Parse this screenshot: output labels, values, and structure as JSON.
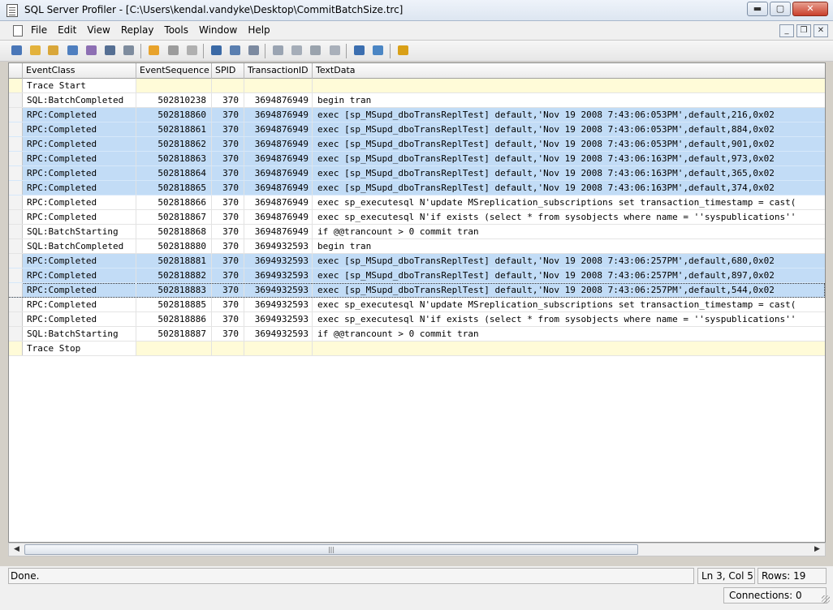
{
  "window": {
    "title": "SQL Server Profiler - [C:\\Users\\kendal.vandyke\\Desktop\\CommitBatchSize.trc]",
    "minimize_glyph": "▬",
    "maximize_glyph": "▢",
    "close_glyph": "✕"
  },
  "menu": {
    "items": [
      "File",
      "Edit",
      "View",
      "Replay",
      "Tools",
      "Window",
      "Help"
    ],
    "mdi_minimize": "_",
    "mdi_restore": "❐",
    "mdi_close": "✕"
  },
  "toolbar": {
    "icons": [
      {
        "name": "new-trace-icon",
        "color": "#4a77b8"
      },
      {
        "name": "new-template-icon",
        "color": "#e3b23c"
      },
      {
        "name": "open-icon",
        "color": "#d9a73a"
      },
      {
        "name": "save-icon",
        "color": "#4f7fbf"
      },
      {
        "name": "properties-icon",
        "color": "#8d6fb3"
      },
      {
        "name": "find-icon",
        "color": "#556f93"
      },
      {
        "name": "clear-trace-icon",
        "color": "#7e8c9e"
      },
      {
        "name": "run-trace-icon",
        "color": "#e8a32c"
      },
      {
        "name": "pause-trace-icon",
        "color": "#9c9c9c"
      },
      {
        "name": "stop-trace-icon",
        "color": "#b0b0b0"
      },
      {
        "name": "step-icon",
        "color": "#3b6aa6"
      },
      {
        "name": "run-to-cursor-icon",
        "color": "#5a7fb0"
      },
      {
        "name": "toggle-breakpoint-icon",
        "color": "#7c8aa0"
      },
      {
        "name": "replay-start-icon",
        "color": "#9aa4b2"
      },
      {
        "name": "replay-pause-icon",
        "color": "#a5adb8"
      },
      {
        "name": "replay-stop-icon",
        "color": "#9aa3ad"
      },
      {
        "name": "replay-step-icon",
        "color": "#a9b0ba"
      },
      {
        "name": "activity-monitor-icon",
        "color": "#3c6fb0"
      },
      {
        "name": "tuning-advisor-icon",
        "color": "#4b86c4"
      },
      {
        "name": "help-icon",
        "color": "#d9a018"
      }
    ]
  },
  "grid": {
    "columns": [
      "EventClass",
      "EventSequence",
      "SPID",
      "TransactionID",
      "TextData"
    ],
    "rows": [
      {
        "event_class": "Trace Start",
        "seq": "",
        "spid": "",
        "tid": "",
        "text": "",
        "kind": "trace"
      },
      {
        "event_class": "SQL:BatchCompleted",
        "seq": "502810238",
        "spid": "370",
        "tid": "3694876949",
        "text": "begin tran",
        "kind": "normal"
      },
      {
        "event_class": "RPC:Completed",
        "seq": "502818860",
        "spid": "370",
        "tid": "3694876949",
        "text": "exec [sp_MSupd_dboTransReplTest] default,'Nov 19 2008  7:43:06:053PM',default,216,0x02",
        "kind": "sel"
      },
      {
        "event_class": "RPC:Completed",
        "seq": "502818861",
        "spid": "370",
        "tid": "3694876949",
        "text": "exec [sp_MSupd_dboTransReplTest] default,'Nov 19 2008  7:43:06:053PM',default,884,0x02",
        "kind": "sel"
      },
      {
        "event_class": "RPC:Completed",
        "seq": "502818862",
        "spid": "370",
        "tid": "3694876949",
        "text": "exec [sp_MSupd_dboTransReplTest] default,'Nov 19 2008  7:43:06:053PM',default,901,0x02",
        "kind": "sel"
      },
      {
        "event_class": "RPC:Completed",
        "seq": "502818863",
        "spid": "370",
        "tid": "3694876949",
        "text": "exec [sp_MSupd_dboTransReplTest] default,'Nov 19 2008  7:43:06:163PM',default,973,0x02",
        "kind": "sel"
      },
      {
        "event_class": "RPC:Completed",
        "seq": "502818864",
        "spid": "370",
        "tid": "3694876949",
        "text": "exec [sp_MSupd_dboTransReplTest] default,'Nov 19 2008  7:43:06:163PM',default,365,0x02",
        "kind": "sel"
      },
      {
        "event_class": "RPC:Completed",
        "seq": "502818865",
        "spid": "370",
        "tid": "3694876949",
        "text": "exec [sp_MSupd_dboTransReplTest] default,'Nov 19 2008  7:43:06:163PM',default,374,0x02",
        "kind": "sel"
      },
      {
        "event_class": "RPC:Completed",
        "seq": "502818866",
        "spid": "370",
        "tid": "3694876949",
        "text": "exec sp_executesql N'update MSreplication_subscriptions set transaction_timestamp = cast(",
        "kind": "normal"
      },
      {
        "event_class": "RPC:Completed",
        "seq": "502818867",
        "spid": "370",
        "tid": "3694876949",
        "text": "exec sp_executesql N'if exists (select * from sysobjects where name = ''syspublications''",
        "kind": "normal"
      },
      {
        "event_class": "SQL:BatchStarting",
        "seq": "502818868",
        "spid": "370",
        "tid": "3694876949",
        "text": " if @@trancount > 0 commit tran",
        "kind": "normal"
      },
      {
        "event_class": "SQL:BatchCompleted",
        "seq": "502818880",
        "spid": "370",
        "tid": "3694932593",
        "text": "begin tran",
        "kind": "normal"
      },
      {
        "event_class": "RPC:Completed",
        "seq": "502818881",
        "spid": "370",
        "tid": "3694932593",
        "text": "exec [sp_MSupd_dboTransReplTest] default,'Nov 19 2008  7:43:06:257PM',default,680,0x02",
        "kind": "sel"
      },
      {
        "event_class": "RPC:Completed",
        "seq": "502818882",
        "spid": "370",
        "tid": "3694932593",
        "text": "exec [sp_MSupd_dboTransReplTest] default,'Nov 19 2008  7:43:06:257PM',default,897,0x02",
        "kind": "sel"
      },
      {
        "event_class": "RPC:Completed",
        "seq": "502818883",
        "spid": "370",
        "tid": "3694932593",
        "text": "exec [sp_MSupd_dboTransReplTest] default,'Nov 19 2008  7:43:06:257PM',default,544,0x02",
        "kind": "sel-focus"
      },
      {
        "event_class": "RPC:Completed",
        "seq": "502818885",
        "spid": "370",
        "tid": "3694932593",
        "text": "exec sp_executesql N'update MSreplication_subscriptions set transaction_timestamp = cast(",
        "kind": "normal"
      },
      {
        "event_class": "RPC:Completed",
        "seq": "502818886",
        "spid": "370",
        "tid": "3694932593",
        "text": "exec sp_executesql N'if exists (select * from sysobjects where name = ''syspublications''",
        "kind": "normal"
      },
      {
        "event_class": "SQL:BatchStarting",
        "seq": "502818887",
        "spid": "370",
        "tid": "3694932593",
        "text": " if @@trancount > 0 commit tran",
        "kind": "normal"
      },
      {
        "event_class": "Trace Stop",
        "seq": "",
        "spid": "",
        "tid": "",
        "text": "",
        "kind": "trace"
      }
    ]
  },
  "scrollbar": {
    "left_arrow": "◀",
    "right_arrow": "▶",
    "thumb_grip": "|||"
  },
  "status": {
    "message": "Done.",
    "position": "Ln 3, Col 5",
    "rows": "Rows: 19",
    "connections": "Connections: 0"
  }
}
